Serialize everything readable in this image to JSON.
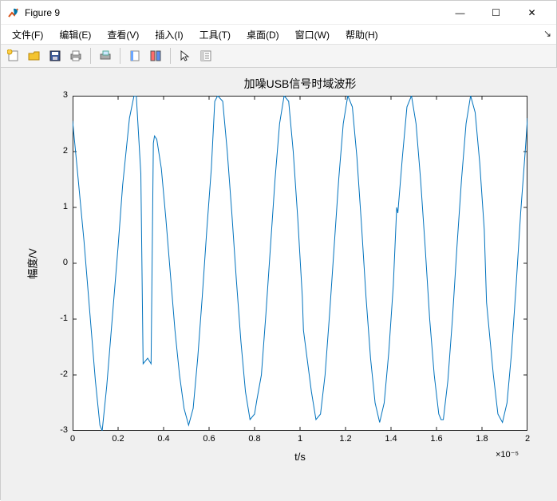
{
  "window": {
    "title": "Figure 9",
    "minimize": "—",
    "maximize": "☐",
    "close": "✕"
  },
  "menu": {
    "file": "文件(F)",
    "edit": "编辑(E)",
    "view": "查看(V)",
    "insert": "插入(I)",
    "tools": "工具(T)",
    "desktop": "桌面(D)",
    "window": "窗口(W)",
    "help": "帮助(H)"
  },
  "toolbar": {
    "new": "new-figure",
    "open": "open",
    "save": "save",
    "print": "print",
    "print_preview": "print-preview",
    "link": "link",
    "color": "colorbar",
    "arrow": "pointer",
    "props": "properties"
  },
  "chart_data": {
    "type": "line",
    "title": "加噪USB信号时域波形",
    "xlabel": "t/s",
    "ylabel": "幅度/V",
    "xlim": [
      0,
      2
    ],
    "ylim": [
      -3,
      3
    ],
    "x_exponent": "×10⁻⁵",
    "xticks": [
      0,
      0.2,
      0.4,
      0.6,
      0.8,
      1,
      1.2,
      1.4,
      1.6,
      1.8,
      2
    ],
    "yticks": [
      -3,
      -2,
      -1,
      0,
      1,
      2,
      3
    ],
    "series": [
      {
        "name": "signal",
        "color": "#0072bd",
        "x": [
          0,
          0.02,
          0.05,
          0.08,
          0.1,
          0.12,
          0.13,
          0.15,
          0.18,
          0.2,
          0.22,
          0.25,
          0.27,
          0.28,
          0.3,
          0.31,
          0.33,
          0.345,
          0.355,
          0.36,
          0.37,
          0.39,
          0.41,
          0.43,
          0.45,
          0.47,
          0.49,
          0.51,
          0.53,
          0.55,
          0.57,
          0.59,
          0.61,
          0.625,
          0.638,
          0.66,
          0.68,
          0.7,
          0.72,
          0.74,
          0.76,
          0.78,
          0.8,
          0.81,
          0.83,
          0.85,
          0.87,
          0.89,
          0.91,
          0.93,
          0.95,
          0.97,
          0.99,
          1.01,
          1.015,
          1.05,
          1.07,
          1.09,
          1.11,
          1.13,
          1.15,
          1.17,
          1.19,
          1.21,
          1.23,
          1.25,
          1.27,
          1.29,
          1.31,
          1.33,
          1.35,
          1.37,
          1.39,
          1.41,
          1.425,
          1.43,
          1.45,
          1.47,
          1.49,
          1.51,
          1.53,
          1.55,
          1.57,
          1.59,
          1.61,
          1.62,
          1.63,
          1.65,
          1.67,
          1.69,
          1.71,
          1.73,
          1.75,
          1.77,
          1.79,
          1.81,
          1.82,
          1.85,
          1.87,
          1.89,
          1.91,
          1.93,
          1.95,
          1.97,
          1.99,
          2.0
        ],
        "y": [
          2.55,
          1.7,
          0.4,
          -1.1,
          -2.1,
          -2.9,
          -3.0,
          -2.2,
          -0.7,
          0.3,
          1.4,
          2.6,
          3.0,
          3.0,
          1.6,
          -1.8,
          -1.7,
          -1.8,
          2.15,
          2.28,
          2.22,
          1.7,
          0.8,
          -0.2,
          -1.2,
          -2.0,
          -2.6,
          -2.9,
          -2.6,
          -1.7,
          -0.6,
          0.6,
          1.7,
          2.9,
          3.0,
          2.9,
          2.0,
          0.9,
          -0.3,
          -1.4,
          -2.3,
          -2.8,
          -2.7,
          -2.45,
          -2.0,
          -0.9,
          0.3,
          1.5,
          2.5,
          3.0,
          2.9,
          2.0,
          0.8,
          -0.6,
          -1.2,
          -2.3,
          -2.8,
          -2.7,
          -2.0,
          -0.9,
          0.3,
          1.5,
          2.5,
          3.0,
          2.8,
          1.9,
          0.7,
          -0.6,
          -1.7,
          -2.5,
          -2.85,
          -2.5,
          -1.6,
          -0.4,
          1.0,
          0.9,
          1.9,
          2.8,
          3.0,
          2.5,
          1.5,
          0.3,
          -1.0,
          -2.0,
          -2.7,
          -2.8,
          -2.8,
          -2.1,
          -1.0,
          0.3,
          1.5,
          2.5,
          3.0,
          2.7,
          1.8,
          0.6,
          -0.7,
          -2.0,
          -2.7,
          -2.85,
          -2.5,
          -1.6,
          -0.4,
          0.9,
          2.0,
          2.6
        ]
      }
    ]
  }
}
